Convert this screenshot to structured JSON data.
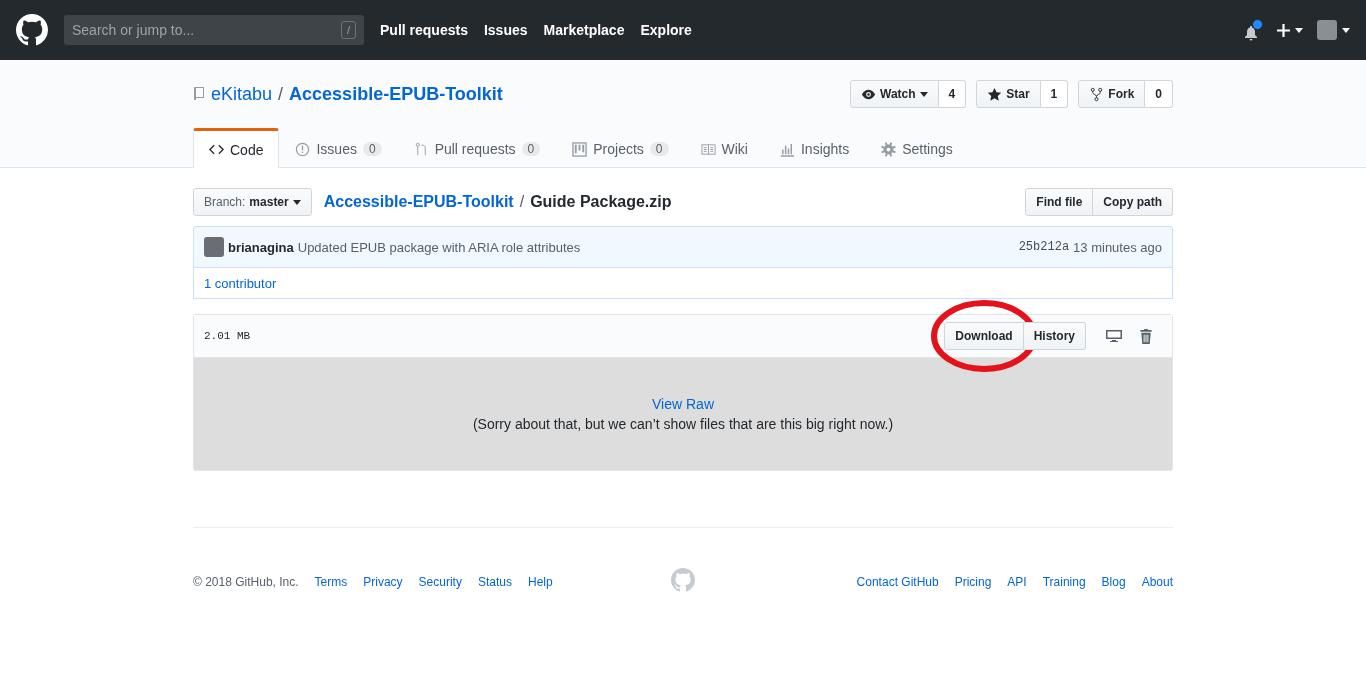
{
  "header": {
    "search": {
      "placeholder": "Search or jump to...",
      "shortcut": "/"
    },
    "nav": [
      "Pull requests",
      "Issues",
      "Marketplace",
      "Explore"
    ],
    "notifications_unread": true
  },
  "repo": {
    "owner": "eKitabu",
    "separator": "/",
    "name": "Accessible-EPUB-Toolkit",
    "actions": [
      {
        "kind": "watch",
        "label": "Watch",
        "count": "4"
      },
      {
        "kind": "star",
        "label": "Star",
        "count": "1"
      },
      {
        "kind": "fork",
        "label": "Fork",
        "count": "0"
      }
    ]
  },
  "tabs": [
    {
      "kind": "code",
      "label": "Code",
      "selected": true
    },
    {
      "kind": "issues",
      "label": "Issues",
      "count": "0",
      "selected": false
    },
    {
      "kind": "pulls",
      "label": "Pull requests",
      "count": "0",
      "selected": false
    },
    {
      "kind": "projects",
      "label": "Projects",
      "count": "0",
      "selected": false
    },
    {
      "kind": "wiki",
      "label": "Wiki",
      "selected": false
    },
    {
      "kind": "insights",
      "label": "Insights",
      "selected": false
    },
    {
      "kind": "settings",
      "label": "Settings",
      "selected": false
    }
  ],
  "branch": {
    "label": "Branch:",
    "name": "master"
  },
  "breadcrumb": {
    "repo": "Accessible-EPUB-Toolkit",
    "separator": "/",
    "file": "Guide Package.zip"
  },
  "file_buttons": [
    "Find file",
    "Copy path"
  ],
  "commit": {
    "author": "brianagina",
    "message": "Updated EPUB package with ARIA role attributes",
    "sha": "25b212a",
    "time": "13 minutes ago"
  },
  "contributors": {
    "count": "1",
    "label": "contributor"
  },
  "file": {
    "size": "2.01 MB",
    "buttons": [
      {
        "label": "Download",
        "circled": true
      },
      {
        "label": "History",
        "circled": false
      }
    ],
    "view_raw": "View Raw",
    "message": "(Sorry about that, but we can’t show files that are this big right now.)"
  },
  "footer": {
    "copyright": "© 2018 GitHub, Inc.",
    "left_links": [
      "Terms",
      "Privacy",
      "Security",
      "Status",
      "Help"
    ],
    "right_links": [
      "Contact GitHub",
      "Pricing",
      "API",
      "Training",
      "Blog",
      "About"
    ]
  }
}
